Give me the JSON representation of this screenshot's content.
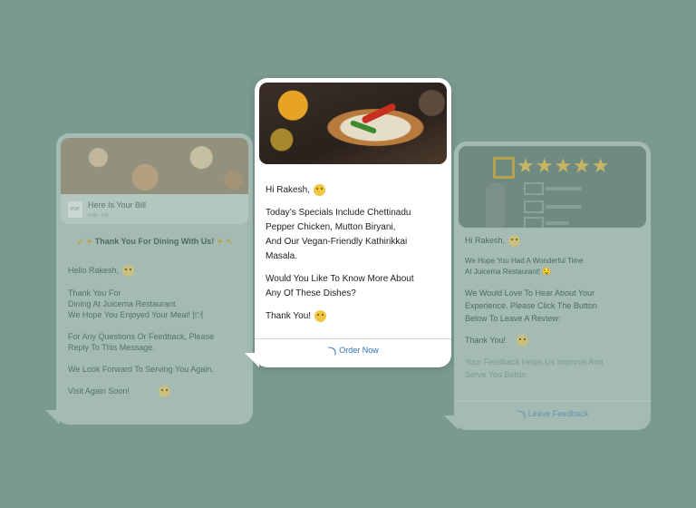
{
  "left_card": {
    "bill_title": "Here Is Your Bill",
    "bill_meta": "KNB - Pdf",
    "thanks": "Thank You For Dining With Us!",
    "greeting": "Hello Rakesh,",
    "para1": "Thank You For\nDining At Juicema Restaurant.\nWe Hope You Enjoyed Your Meal! 🍽",
    "para2": "For Any Questions Or Feedback, Please\nReply To This Message.",
    "para3": "We Look Forward To Serving You Again.",
    "closing": "Visit Again Soon!"
  },
  "center_card": {
    "greeting": "Hi Rakesh,",
    "para1": "Today’s Specials Include Chettinadu\nPepper Chicken, Mutton Biryani,\nAnd Our Vegan-Friendly Kathirikkai\nMasala.",
    "para2": "Would You Like To Know More About\nAny Of These Dishes?",
    "closing": "Thank You!",
    "cta": "Order Now"
  },
  "right_card": {
    "greeting": "Hi Rakesh,",
    "para1": "We Hope You Had A Wonderful Time\nAt Juicema Restaurant! 🤤",
    "para2": "We Would Love To Hear About Your\nExperience. Please Click The Button\nBelow To Leave A Review:",
    "closing": "Thank You!",
    "note": "Your Feedback Helps Us Improve And\nServe You Better.",
    "cta": "Leave Feedback",
    "stars": "★★★★★"
  },
  "colors": {
    "background": "#7a9990",
    "link": "#2d6fb3",
    "faded_bubble": "#a3bbb3"
  }
}
